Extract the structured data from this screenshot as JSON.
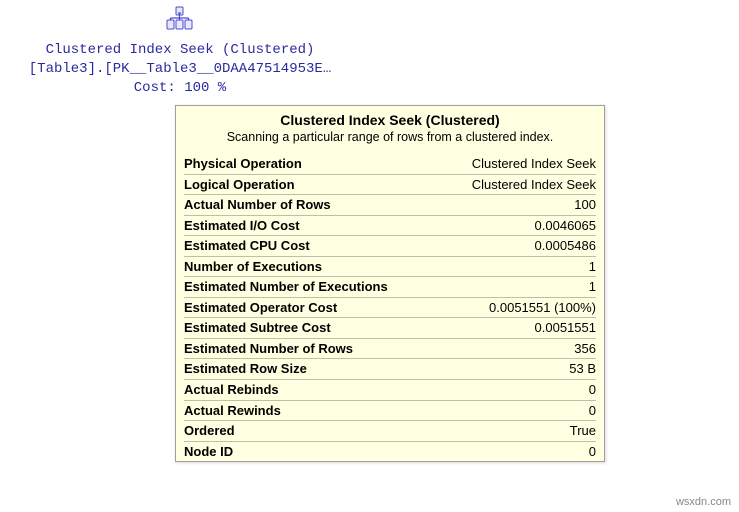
{
  "plan_node": {
    "title": "Clustered Index Seek (Clustered)",
    "object": "[Table3].[PK__Table3__0DAA47514953E…",
    "cost": "Cost: 100 %"
  },
  "tooltip": {
    "title": "Clustered Index Seek (Clustered)",
    "description": "Scanning a particular range of rows from a clustered index.",
    "props": [
      {
        "label": "Physical Operation",
        "value": "Clustered Index Seek"
      },
      {
        "label": "Logical Operation",
        "value": "Clustered Index Seek"
      },
      {
        "label": "Actual Number of Rows",
        "value": "100"
      },
      {
        "label": "Estimated I/O Cost",
        "value": "0.0046065"
      },
      {
        "label": "Estimated CPU Cost",
        "value": "0.0005486"
      },
      {
        "label": "Number of Executions",
        "value": "1"
      },
      {
        "label": "Estimated Number of Executions",
        "value": "1"
      },
      {
        "label": "Estimated Operator Cost",
        "value": "0.0051551 (100%)"
      },
      {
        "label": "Estimated Subtree Cost",
        "value": "0.0051551"
      },
      {
        "label": "Estimated Number of Rows",
        "value": "356"
      },
      {
        "label": "Estimated Row Size",
        "value": "53 B"
      },
      {
        "label": "Actual Rebinds",
        "value": "0"
      },
      {
        "label": "Actual Rewinds",
        "value": "0"
      },
      {
        "label": "Ordered",
        "value": "True"
      },
      {
        "label": "Node ID",
        "value": "0"
      }
    ]
  },
  "watermark": "wsxdn.com"
}
